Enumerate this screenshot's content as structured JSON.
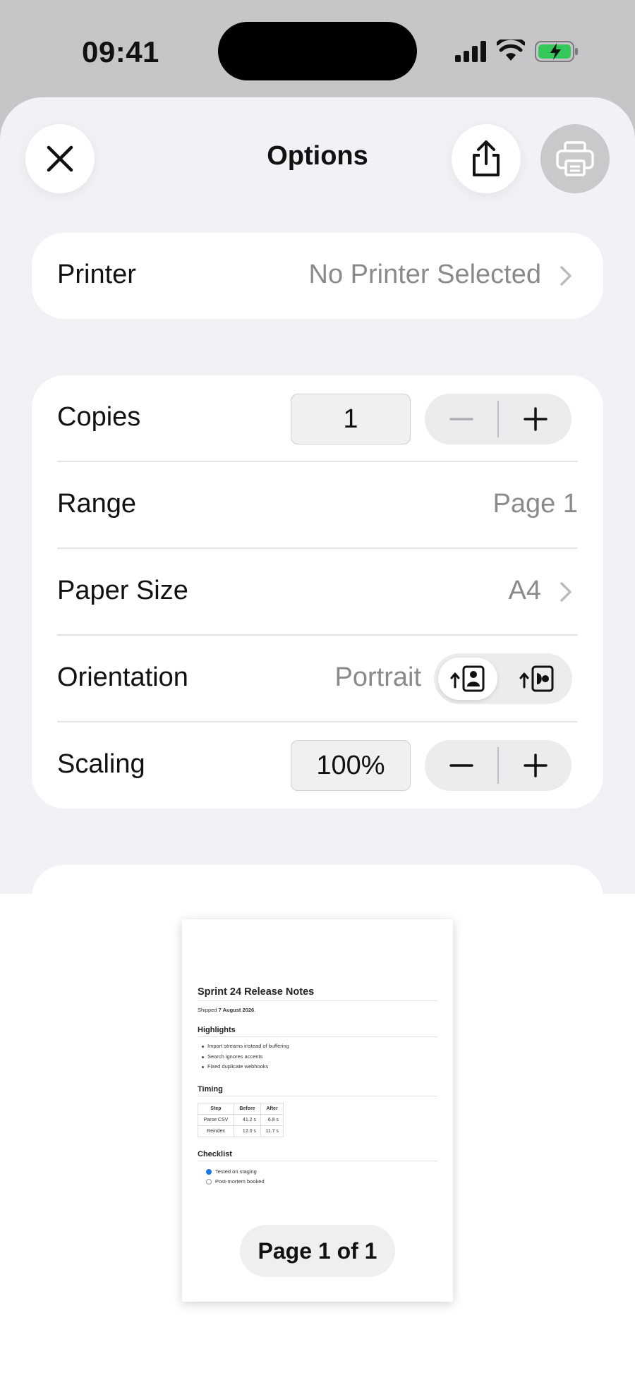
{
  "status_bar": {
    "time": "09:41"
  },
  "header": {
    "title": "Options"
  },
  "printer": {
    "label": "Printer",
    "value": "No Printer Selected"
  },
  "options": {
    "copies": {
      "label": "Copies",
      "value": "1"
    },
    "range": {
      "label": "Range",
      "value": "Page 1"
    },
    "paper_size": {
      "label": "Paper Size",
      "value": "A4"
    },
    "orientation": {
      "label": "Orientation",
      "value": "Portrait",
      "selected": "portrait"
    },
    "scaling": {
      "label": "Scaling",
      "value": "100%"
    }
  },
  "preview": {
    "doc_title": "Sprint 24 Release Notes",
    "shipped_prefix": "Shipped ",
    "shipped_date": "7 August 2026",
    "shipped_suffix": ".",
    "highlights_heading": "Highlights",
    "highlights": [
      "Import streams instead of buffering",
      "Search ignores accents",
      "Fixed duplicate webhooks"
    ],
    "timing_heading": "Timing",
    "timing_table": {
      "headers": [
        "Step",
        "Before",
        "After"
      ],
      "rows": [
        [
          "Parse CSV",
          "41.2 s",
          "6.8 s"
        ],
        [
          "Reindex",
          "12.0 s",
          "11.7 s"
        ]
      ]
    },
    "checklist_heading": "Checklist",
    "checklist": [
      {
        "label": "Tested on staging",
        "checked": true
      },
      {
        "label": "Post-mortem booked",
        "checked": false
      }
    ],
    "page_indicator": "Page 1 of 1"
  },
  "colors": {
    "accent_check": "#1a73e8",
    "sheet_bg": "#f1f1f6",
    "battery_green": "#34c759"
  }
}
